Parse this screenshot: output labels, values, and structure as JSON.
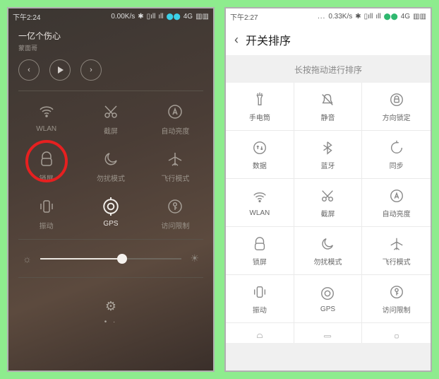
{
  "left": {
    "status": {
      "time": "下午2:24",
      "speed": "0.00K/s",
      "network": "4G"
    },
    "music": {
      "title": "一亿个伤心",
      "artist": "蒙面哥"
    },
    "tiles": [
      {
        "id": "wlan",
        "label": "WLAN"
      },
      {
        "id": "screenshot",
        "label": "截屏"
      },
      {
        "id": "autobright",
        "label": "自动亮度"
      },
      {
        "id": "lockscreen",
        "label": "锁屏"
      },
      {
        "id": "dnd",
        "label": "勿扰模式"
      },
      {
        "id": "airplane",
        "label": "飞行模式"
      },
      {
        "id": "vibrate",
        "label": "振动"
      },
      {
        "id": "gps",
        "label": "GPS"
      },
      {
        "id": "restrict",
        "label": "访问限制"
      }
    ],
    "brightness_pct": 58
  },
  "right": {
    "status": {
      "time": "下午2:27",
      "speed": "0.33K/s",
      "network": "4G"
    },
    "title": "开关排序",
    "instruction": "长按拖动进行排序",
    "tiles": [
      {
        "id": "flashlight",
        "label": "手电筒"
      },
      {
        "id": "mute",
        "label": "静音"
      },
      {
        "id": "orientation",
        "label": "方向锁定"
      },
      {
        "id": "data",
        "label": "数据"
      },
      {
        "id": "bluetooth",
        "label": "蓝牙"
      },
      {
        "id": "sync",
        "label": "同步"
      },
      {
        "id": "wlan",
        "label": "WLAN"
      },
      {
        "id": "screenshot",
        "label": "截屏"
      },
      {
        "id": "autobright",
        "label": "自动亮度"
      },
      {
        "id": "lockscreen",
        "label": "锁屏"
      },
      {
        "id": "dnd",
        "label": "勿扰模式"
      },
      {
        "id": "airplane",
        "label": "飞行模式"
      },
      {
        "id": "vibrate",
        "label": "振动"
      },
      {
        "id": "gps",
        "label": "GPS"
      },
      {
        "id": "restrict",
        "label": "访问限制"
      }
    ]
  }
}
